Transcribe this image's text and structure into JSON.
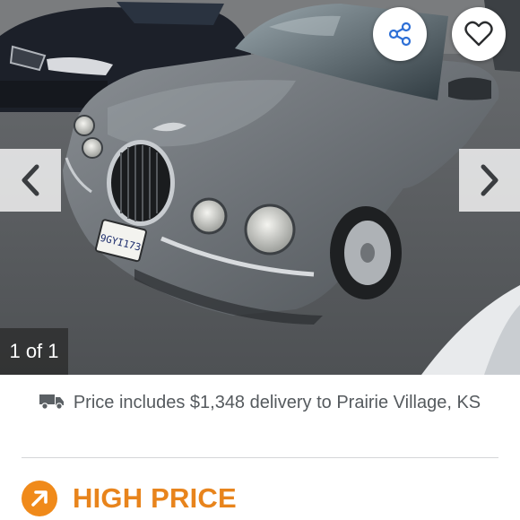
{
  "gallery": {
    "photo_alt": "Gray Jaguar sedan parked in a lot",
    "counter": "1 of 1",
    "share_icon": "share-icon",
    "favorite_icon": "heart-icon",
    "prev_icon": "chevron-left-icon",
    "next_icon": "chevron-right-icon",
    "plate_text": "9GYI173"
  },
  "delivery": {
    "icon": "truck-icon",
    "text": "Price includes $1,348 delivery to Prairie Village, KS"
  },
  "price_rating": {
    "icon": "arrow-up-right-icon",
    "label": "HIGH PRICE",
    "color": "#f08a1a"
  }
}
